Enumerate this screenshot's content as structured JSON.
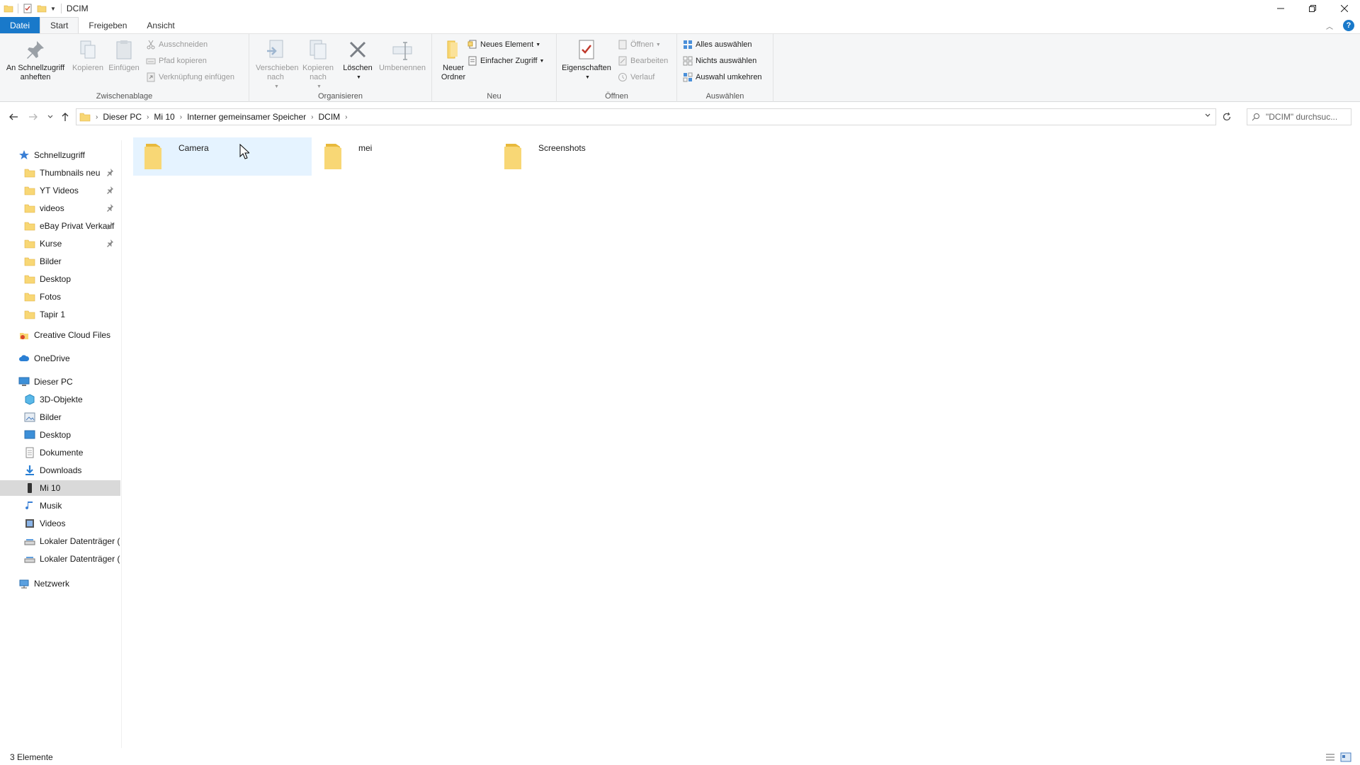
{
  "window": {
    "title": "DCIM"
  },
  "ribbon_tabs": [
    "Datei",
    "Start",
    "Freigeben",
    "Ansicht"
  ],
  "ribbon": {
    "clipboard": {
      "label": "Zwischenablage",
      "pin": "An Schnellzugriff anheften",
      "copy": "Kopieren",
      "paste": "Einfügen",
      "cut": "Ausschneiden",
      "copy_path": "Pfad kopieren",
      "paste_shortcut": "Verknüpfung einfügen"
    },
    "organize": {
      "label": "Organisieren",
      "move_to": "Verschieben nach",
      "copy_to": "Kopieren nach",
      "delete": "Löschen",
      "rename": "Umbenennen"
    },
    "new": {
      "label": "Neu",
      "new_folder": "Neuer Ordner",
      "new_item": "Neues Element",
      "easy_access": "Einfacher Zugriff"
    },
    "open": {
      "label": "Öffnen",
      "properties": "Eigenschaften",
      "open": "Öffnen",
      "edit": "Bearbeiten",
      "history": "Verlauf"
    },
    "select": {
      "label": "Auswählen",
      "select_all": "Alles auswählen",
      "select_none": "Nichts auswählen",
      "invert": "Auswahl umkehren"
    }
  },
  "address": {
    "breadcrumbs": [
      "Dieser PC",
      "Mi 10",
      "Interner gemeinsamer Speicher",
      "DCIM"
    ],
    "search_placeholder": "\"DCIM\" durchsuc..."
  },
  "nav": {
    "quick_access": "Schnellzugriff",
    "quick_items": [
      {
        "label": "Thumbnails neu",
        "pinned": true
      },
      {
        "label": "YT Videos",
        "pinned": true
      },
      {
        "label": "videos",
        "pinned": true
      },
      {
        "label": "eBay Privat Verkauf",
        "pinned": true
      },
      {
        "label": "Kurse",
        "pinned": true
      },
      {
        "label": "Bilder",
        "pinned": false
      },
      {
        "label": "Desktop",
        "pinned": false
      },
      {
        "label": "Fotos",
        "pinned": false
      },
      {
        "label": "Tapir 1",
        "pinned": false
      }
    ],
    "creative_cloud": "Creative Cloud Files",
    "onedrive": "OneDrive",
    "this_pc": "Dieser PC",
    "pc_items": [
      "3D-Objekte",
      "Bilder",
      "Desktop",
      "Dokumente",
      "Downloads",
      "Mi 10",
      "Musik",
      "Videos",
      "Lokaler Datenträger (C",
      "Lokaler Datenträger (D"
    ],
    "selected": "Mi 10",
    "network": "Netzwerk"
  },
  "folders": [
    "Camera",
    "mei",
    "Screenshots"
  ],
  "status": {
    "count": "3 Elemente"
  },
  "colors": {
    "accent": "#1979ca",
    "folder": "#f8d775",
    "folder_dark": "#e8b93c",
    "hover": "#e5f3ff",
    "nav_selected": "#d9d9d9"
  }
}
